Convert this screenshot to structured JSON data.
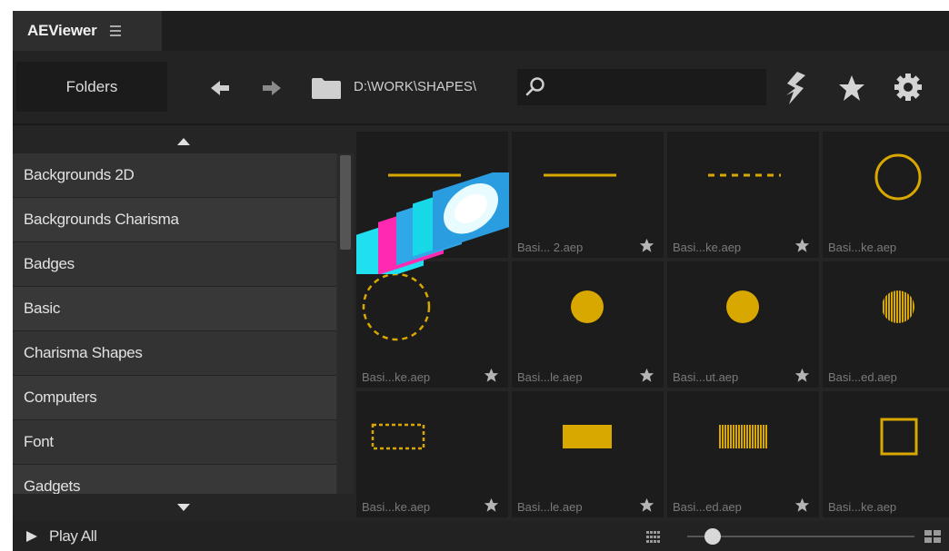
{
  "app": {
    "tab_title": "AEViewer",
    "tab_menu_icon": "hamburger-icon"
  },
  "toolbar": {
    "folders_label": "Folders",
    "path": "D:\\WORK\\SHAPES\\",
    "search_value": "",
    "icons": [
      "back-arrow-icon",
      "forward-arrow-icon",
      "folder-icon",
      "search-icon",
      "clean-icon",
      "star-icon",
      "gear-icon"
    ]
  },
  "sidebar": {
    "items": [
      {
        "label": "Backgrounds 2D"
      },
      {
        "label": "Backgrounds Charisma"
      },
      {
        "label": "Badges"
      },
      {
        "label": "Basic"
      },
      {
        "label": "Charisma Shapes"
      },
      {
        "label": "Computers"
      },
      {
        "label": "Font"
      },
      {
        "label": "Gadgets"
      }
    ]
  },
  "grid": {
    "tiles": [
      {
        "name": "",
        "shape": "line"
      },
      {
        "name": "Basi... 2.aep",
        "shape": "line"
      },
      {
        "name": "Basi...ke.aep",
        "shape": "dashed-line"
      },
      {
        "name": "Basi...ke.aep",
        "shape": "circle-outline"
      },
      {
        "name": "Basi...ke.aep",
        "shape": "dashed-circle"
      },
      {
        "name": "Basi...le.aep",
        "shape": "filled-circle"
      },
      {
        "name": "Basi...ut.aep",
        "shape": "filled-circle"
      },
      {
        "name": "Basi...ed.aep",
        "shape": "striped-circle"
      },
      {
        "name": "Basi...ke.aep",
        "shape": "dashed-rect"
      },
      {
        "name": "Basi...le.aep",
        "shape": "filled-rect"
      },
      {
        "name": "Basi...ed.aep",
        "shape": "striped-rect"
      },
      {
        "name": "Basi...ke.aep",
        "shape": "square-outline"
      }
    ]
  },
  "footer": {
    "play_all_label": "Play All",
    "zoom_level": 0.08
  },
  "colors": {
    "accent": "#d9a800",
    "panel_bg": "#252525",
    "tile_bg": "#1c1c1c"
  }
}
